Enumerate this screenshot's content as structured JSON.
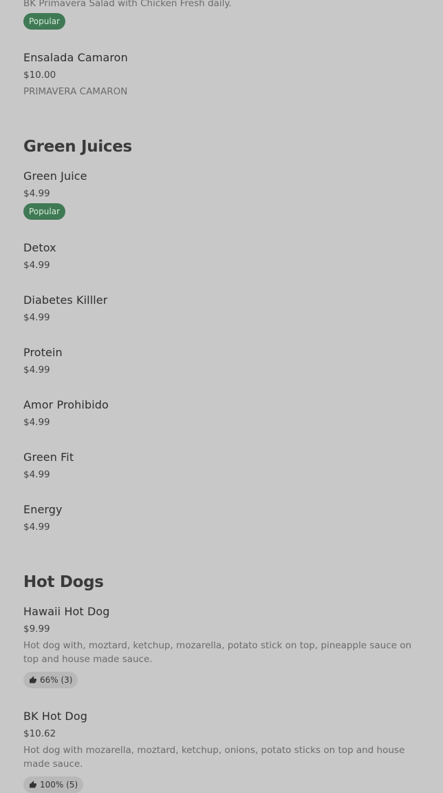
{
  "top_item": {
    "description": "BK Primavera Salad with Chicken Fresh daily.",
    "badge": "Popular"
  },
  "ensalada_camaron": {
    "name": "Ensalada Camaron",
    "price": "$10.00",
    "description": "PRIMAVERA CAMARON"
  },
  "green_juices": {
    "title": "Green Juices",
    "items": [
      {
        "name": "Green Juice",
        "price": "$4.99",
        "badge": "Popular"
      },
      {
        "name": "Detox",
        "price": "$4.99"
      },
      {
        "name": "Diabetes Killler",
        "price": "$4.99"
      },
      {
        "name": "Protein",
        "price": "$4.99"
      },
      {
        "name": "Amor Prohibido",
        "price": "$4.99"
      },
      {
        "name": "Green Fit",
        "price": "$4.99"
      },
      {
        "name": "Energy",
        "price": "$4.99"
      }
    ]
  },
  "hot_dogs": {
    "title": "Hot Dogs",
    "items": [
      {
        "name": "Hawaii Hot Dog",
        "price": "$9.99",
        "description": "Hot dog with, moztard, ketchup, mozarella, potato stick on top, pineapple sauce on top and house made sauce.",
        "rating": "66% (3)",
        "rating_icon": "thumbs-up-icon"
      },
      {
        "name": "BK Hot Dog",
        "price": "$10.62",
        "description": "Hot dog with mozarella, moztard, ketchup, onions, potato sticks on top and house made sauce.",
        "rating": "100% (5)",
        "rating_icon": "thumbs-up-icon"
      }
    ]
  },
  "colors": {
    "background": "#c8c8c8",
    "popular_badge": "#3f7a55",
    "rating_badge": "#b8b8b8"
  }
}
